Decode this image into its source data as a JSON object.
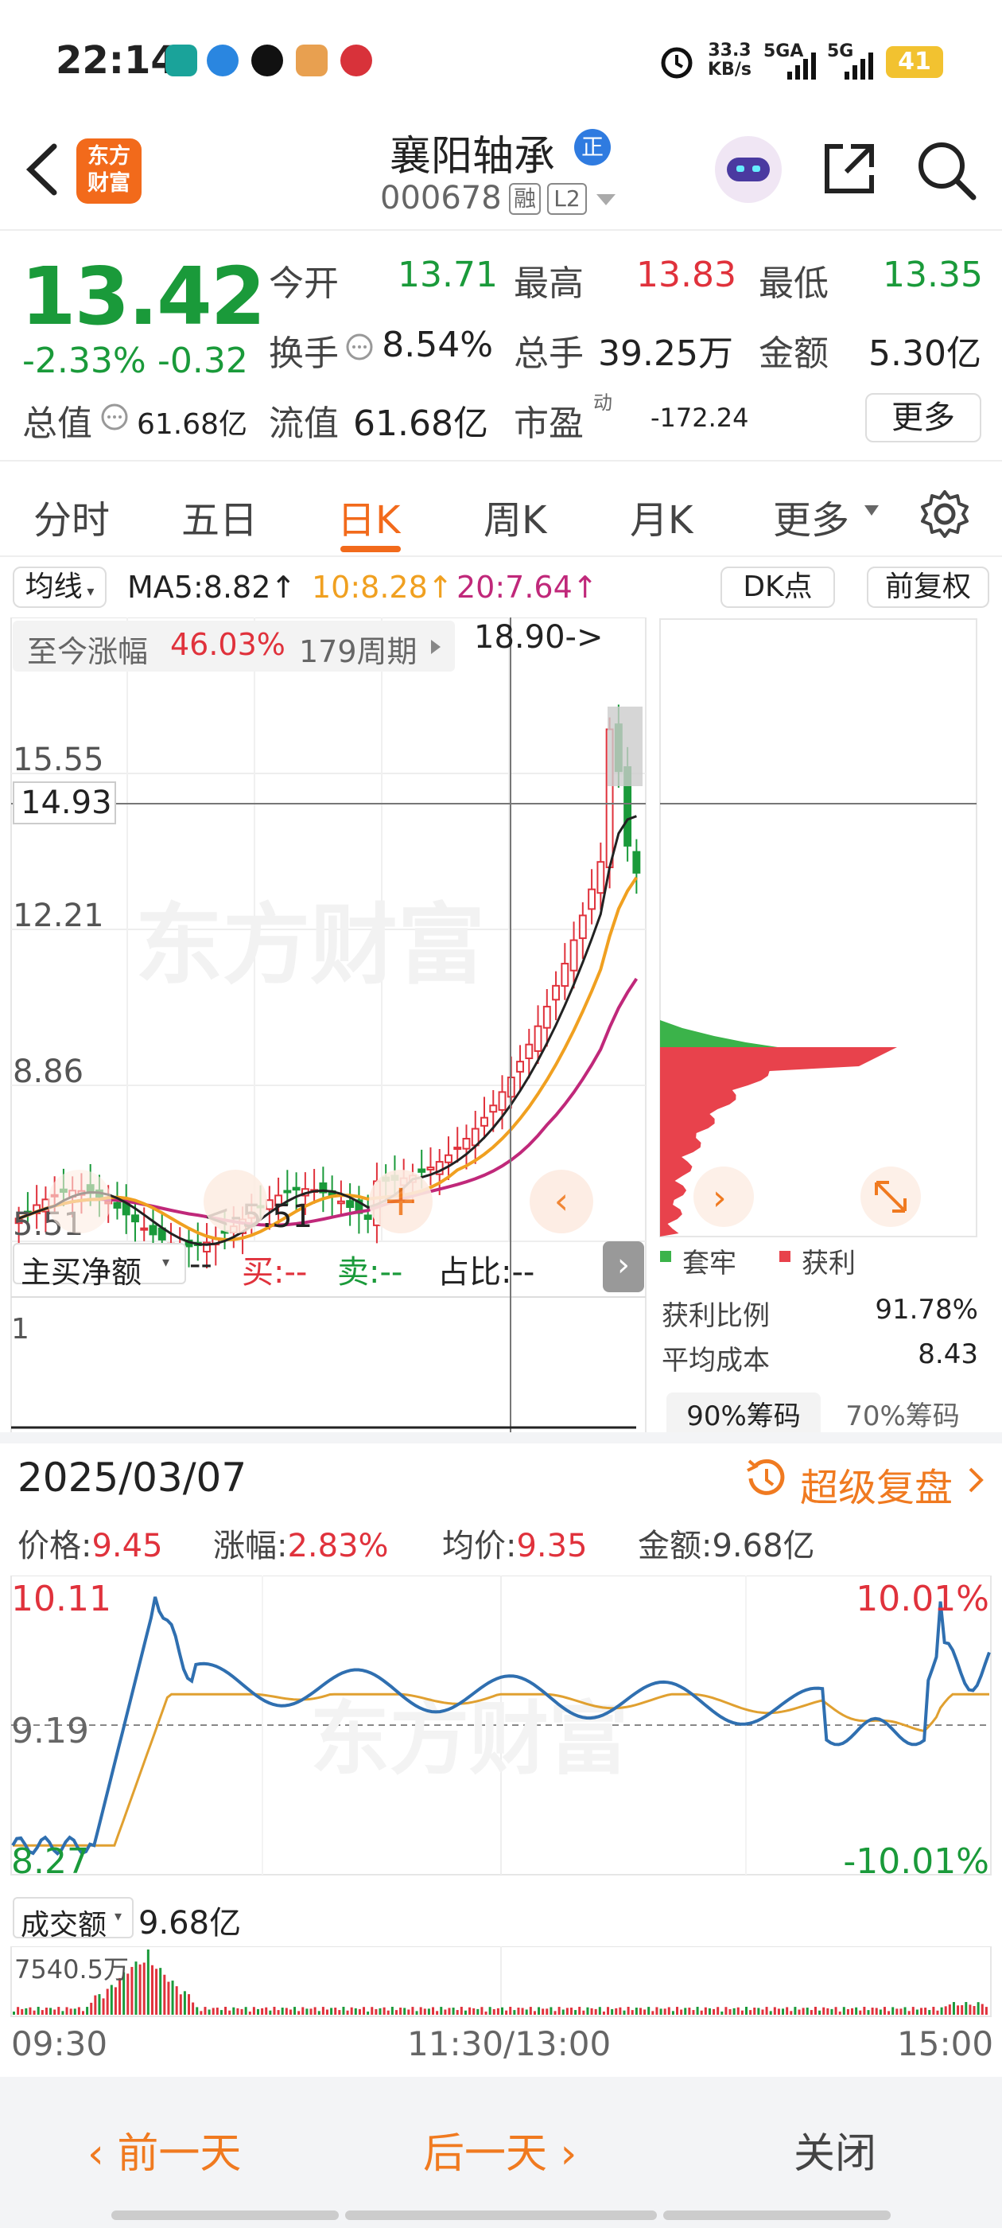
{
  "status": {
    "time": "22:14",
    "net_speed_value": "33.3",
    "net_speed_unit": "KB/s",
    "net1": "5GA",
    "net2": "5G",
    "battery": "41"
  },
  "header": {
    "logo_line1": "东方",
    "logo_line2": "财富",
    "stock_name": "襄阳轴承",
    "stock_code": "000678",
    "badge_rong": "融",
    "badge_l2": "L2",
    "zheng": "正"
  },
  "quote": {
    "price": "13.42",
    "change_pct": "-2.33%",
    "change_amt": "-0.32",
    "open_label": "今开",
    "open": "13.71",
    "high_label": "最高",
    "high": "13.83",
    "low_label": "最低",
    "low": "13.35",
    "turnover_label": "换手",
    "turnover": "8.54%",
    "volume_label": "总手",
    "volume": "39.25万",
    "amount_label": "金额",
    "amount": "5.30亿",
    "mktcap_label": "总值",
    "mktcap": "61.68亿",
    "float_label": "流值",
    "float": "61.68亿",
    "pe_label": "市盈",
    "pe_sup": "动",
    "pe": "-172.24",
    "more": "更多"
  },
  "tabs": [
    "分时",
    "五日",
    "日K",
    "周K",
    "月K",
    "更多"
  ],
  "kline": {
    "indicator": "均线",
    "ma5": "MA5:8.82",
    "ma10": "10:8.28",
    "ma20": "20:7.64",
    "arrow": "↑",
    "dk_label": "DK点",
    "fq_label": "前复权",
    "gain_label": "至今涨幅",
    "gain_value": "46.03%",
    "period": "179周期",
    "high_mark": "18.90->",
    "low_mark": "<-5.51",
    "y_labels": [
      "15.55",
      "12.21",
      "8.86",
      "5.51"
    ],
    "crosshair_value": "14.93",
    "watermark": "东方财富"
  },
  "chip": {
    "legend_trapped": "套牢",
    "legend_profit": "获利",
    "profit_ratio_label": "获利比例",
    "profit_ratio": "91.78%",
    "avg_cost_label": "平均成本",
    "avg_cost": "8.43",
    "tab90": "90%筹码",
    "tab70": "70%筹码"
  },
  "flow": {
    "label": "主买净额",
    "value": "--",
    "buy_label": "买:",
    "buy": "--",
    "sell_label": "卖:",
    "sell": "--",
    "ratio_label": "占比:",
    "ratio": "--",
    "axis": "1"
  },
  "intraday": {
    "date": "2025/03/07",
    "replay": "超级复盘",
    "price_label": "价格:",
    "price": "9.45",
    "chg_label": "涨幅:",
    "chg": "2.83%",
    "avg_label": "均价:",
    "avg": "9.35",
    "amount_label": "金额:",
    "amount": "9.68亿",
    "y_top": "10.11",
    "y_mid": "9.19",
    "y_bot": "8.27",
    "pct_top": "10.01%",
    "pct_bot": "-10.01%",
    "vol_label": "成交额",
    "vol_total": "9.68亿",
    "vol_max": "7540.5万",
    "t_start": "09:30",
    "t_mid": "11:30/13:00",
    "t_end": "15:00"
  },
  "bottom": {
    "prev": "前一天",
    "next": "后一天",
    "close": "关闭"
  },
  "colors": {
    "up": "#e0323c",
    "down": "#1a9a3a",
    "brand": "#f26a1b",
    "ma5": "#222222",
    "ma10": "#f0a020",
    "ma20": "#c0287a",
    "price_line": "#2f6fb0",
    "avg_line": "#e0a030"
  }
}
